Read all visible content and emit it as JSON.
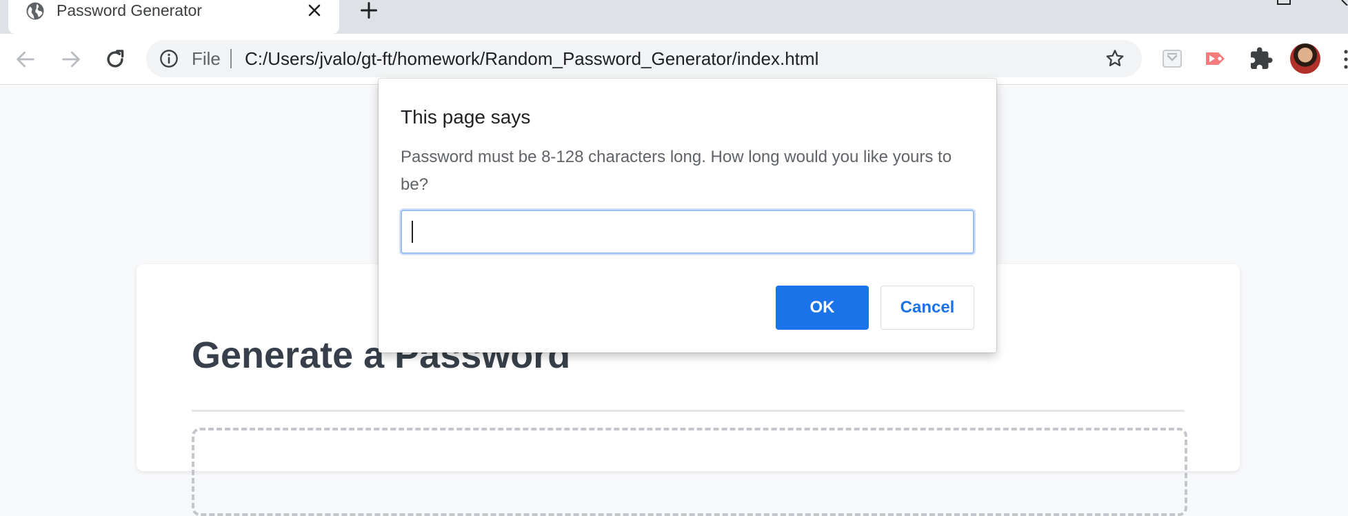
{
  "browser": {
    "tab": {
      "title": "Password Generator",
      "favicon": "globe-icon",
      "close_icon": "close-icon"
    },
    "new_tab_icon": "plus-icon",
    "toolbar": {
      "back_icon": "arrow-left-icon",
      "forward_icon": "arrow-right-icon",
      "reload_icon": "reload-icon",
      "site_info_icon": "info-icon",
      "scheme_label": "File",
      "url": "C:/Users/jvalo/gt-ft/homework/Random_Password_Generator/index.html",
      "bookmark_icon": "star-icon",
      "extensions": [
        "pocket-icon",
        "cast-icon",
        "puzzle-icon"
      ],
      "profile_avatar": "avatar",
      "menu_icon": "more-vert-icon"
    }
  },
  "page": {
    "heading": "Generate a Password"
  },
  "dialog": {
    "title": "This page says",
    "message": "Password must be 8-128 characters long. How long would you like yours to be?",
    "input_value": "",
    "ok_label": "OK",
    "cancel_label": "Cancel"
  },
  "colors": {
    "accent": "#1a73e8",
    "heading": "#37404a",
    "page_bg": "#f7f8fa"
  }
}
